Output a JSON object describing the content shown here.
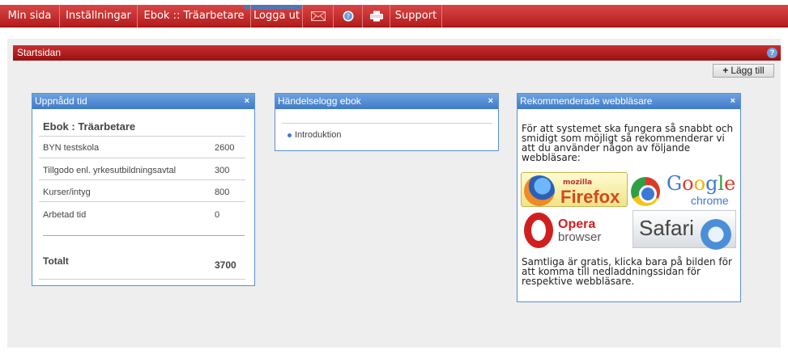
{
  "nav": {
    "items": [
      "Min sida",
      "Inställningar",
      "Ebok :: Träarbetare",
      "Logga ut"
    ],
    "support": "Support",
    "icons": [
      "mail-icon",
      "help-icon",
      "print-icon"
    ]
  },
  "page": {
    "title": "Startsidan",
    "add_button": "Lägg till"
  },
  "widget_time": {
    "title": "Uppnådd tid",
    "subtitle": "Ebok : Träarbetare",
    "rows": [
      {
        "label": "BYN testskola",
        "value": "2600"
      },
      {
        "label": "Tillgodo enl. yrkesutbildningsavtal",
        "value": "300"
      },
      {
        "label": "Kurser/intyg",
        "value": "800"
      },
      {
        "label": "Arbetad tid",
        "value": "0"
      }
    ],
    "total_label": "Totalt",
    "total_value": "3700"
  },
  "widget_log": {
    "title": "Händelselogg ebok",
    "items": [
      "Introduktion"
    ]
  },
  "widget_browsers": {
    "title": "Rekommenderade webbläsare",
    "intro": "För att systemet ska fungera så snabbt och smidigt som möjligt så rekommenderar vi att du använder någon av följande webbläsare:",
    "outro": "Samtliga är gratis, klicka bara på bilden för att komma till nedladdningssidan för respektive webbläsare.",
    "browsers": {
      "firefox_small": "mozilla",
      "firefox": "Firefox",
      "google": "Google",
      "chrome": "chrome",
      "opera": "Opera",
      "opera_browser": "browser",
      "safari": "Safari"
    }
  },
  "colors": {
    "nav_red": "#c02a2a",
    "widget_blue": "#5b8fd2"
  }
}
